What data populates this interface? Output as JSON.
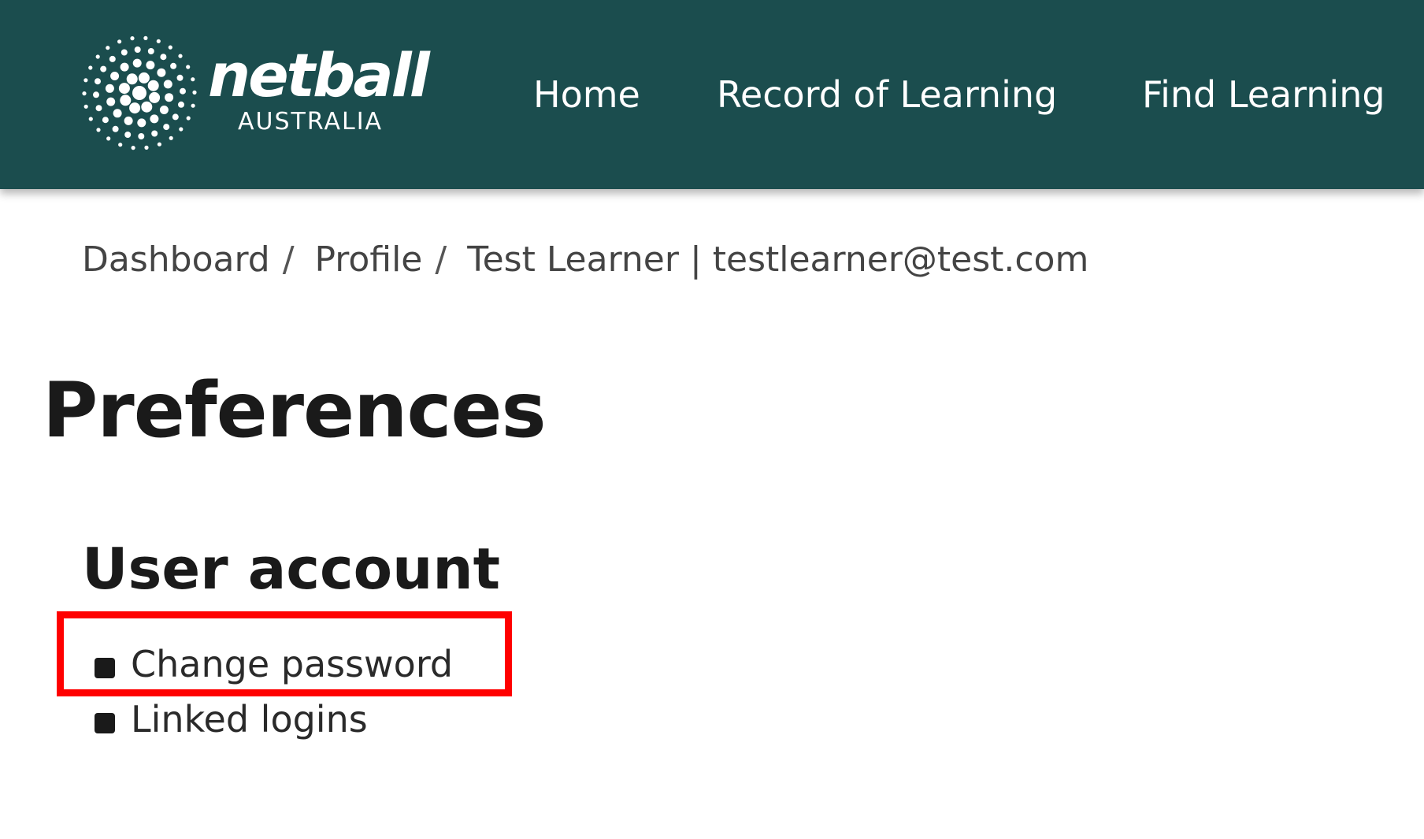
{
  "header": {
    "logo": {
      "wordmark": "netball",
      "subtext": "AUSTRALIA"
    },
    "nav": [
      {
        "label": "Home"
      },
      {
        "label": "Record of Learning"
      },
      {
        "label": "Find Learning"
      }
    ]
  },
  "breadcrumb": {
    "items": [
      {
        "label": "Dashboard"
      },
      {
        "label": "Profile"
      },
      {
        "label": "Test Learner | testlearner@test.com"
      }
    ],
    "separator": "/"
  },
  "page": {
    "title": "Preferences",
    "section_title": "User account",
    "links": [
      {
        "label": "Change password",
        "highlighted": true
      },
      {
        "label": "Linked logins",
        "highlighted": false
      }
    ]
  },
  "colors": {
    "header_bg": "#1b4d4e",
    "highlight": "#ff0000",
    "text": "#1a1a1a"
  },
  "icons": {
    "logo_mark": "netball-starburst-icon",
    "bullet": "square-bullet-icon"
  }
}
